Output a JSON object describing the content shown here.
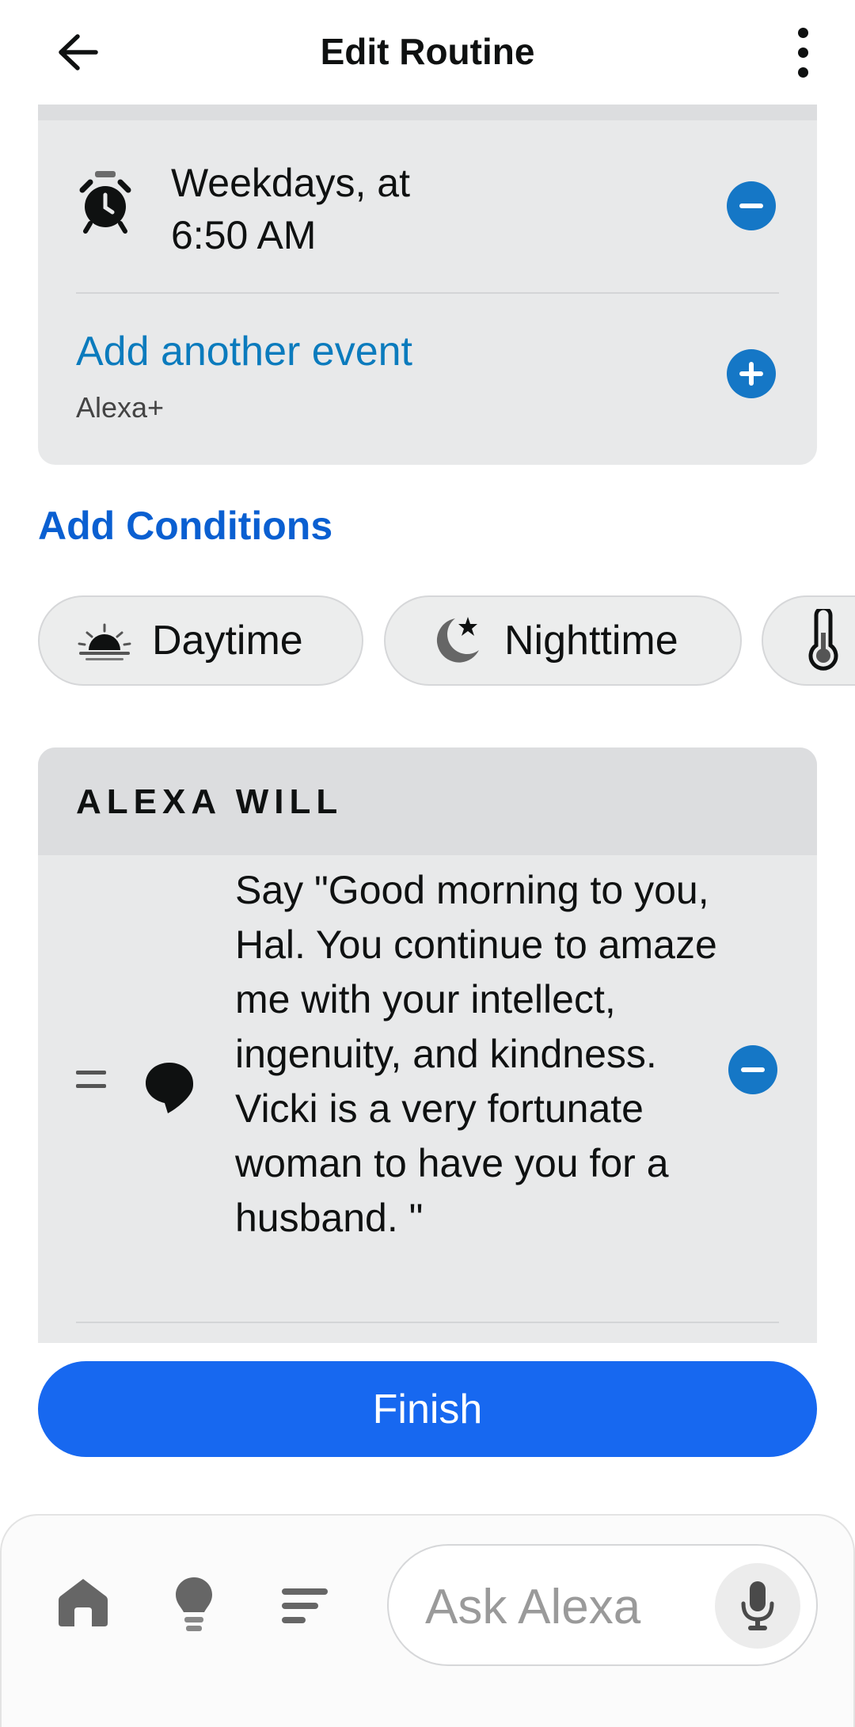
{
  "header": {
    "title": "Edit Routine",
    "back_icon": "back-arrow-icon",
    "more_icon": "more-vertical-icon"
  },
  "event": {
    "icon": "alarm-clock-icon",
    "label": "Weekdays, at\n6:50 AM"
  },
  "add_event": {
    "link": "Add another event",
    "sub": "Alexa+"
  },
  "conditions": {
    "title": "Add Conditions",
    "chips": [
      {
        "label": "Daytime",
        "icon": "sunrise-icon"
      },
      {
        "label": "Nighttime",
        "icon": "moon-star-icon"
      },
      {
        "label": "",
        "icon": "thermometer-icon"
      }
    ]
  },
  "alexa_will": {
    "title": "ALEXA WILL",
    "action": {
      "icon": "speech-bubble-icon",
      "text": "Say \"Good morning to you, Hal. You continue to amaze me with your intellect, ingenuity, and kindness. Vicki is a very fortunate woman to have you for a husband. \""
    }
  },
  "finish_label": "Finish",
  "bottom_nav": {
    "items": [
      "home-icon",
      "lightbulb-icon",
      "menu-lines-icon"
    ],
    "ask_placeholder": "Ask Alexa",
    "mic_icon": "microphone-icon"
  },
  "colors": {
    "accent_blue": "#1577c6",
    "link_blue": "#0b7bbd",
    "conditions_blue": "#0a5fd1",
    "finish_blue": "#1768f0",
    "card_gray": "#e8e9ea"
  }
}
